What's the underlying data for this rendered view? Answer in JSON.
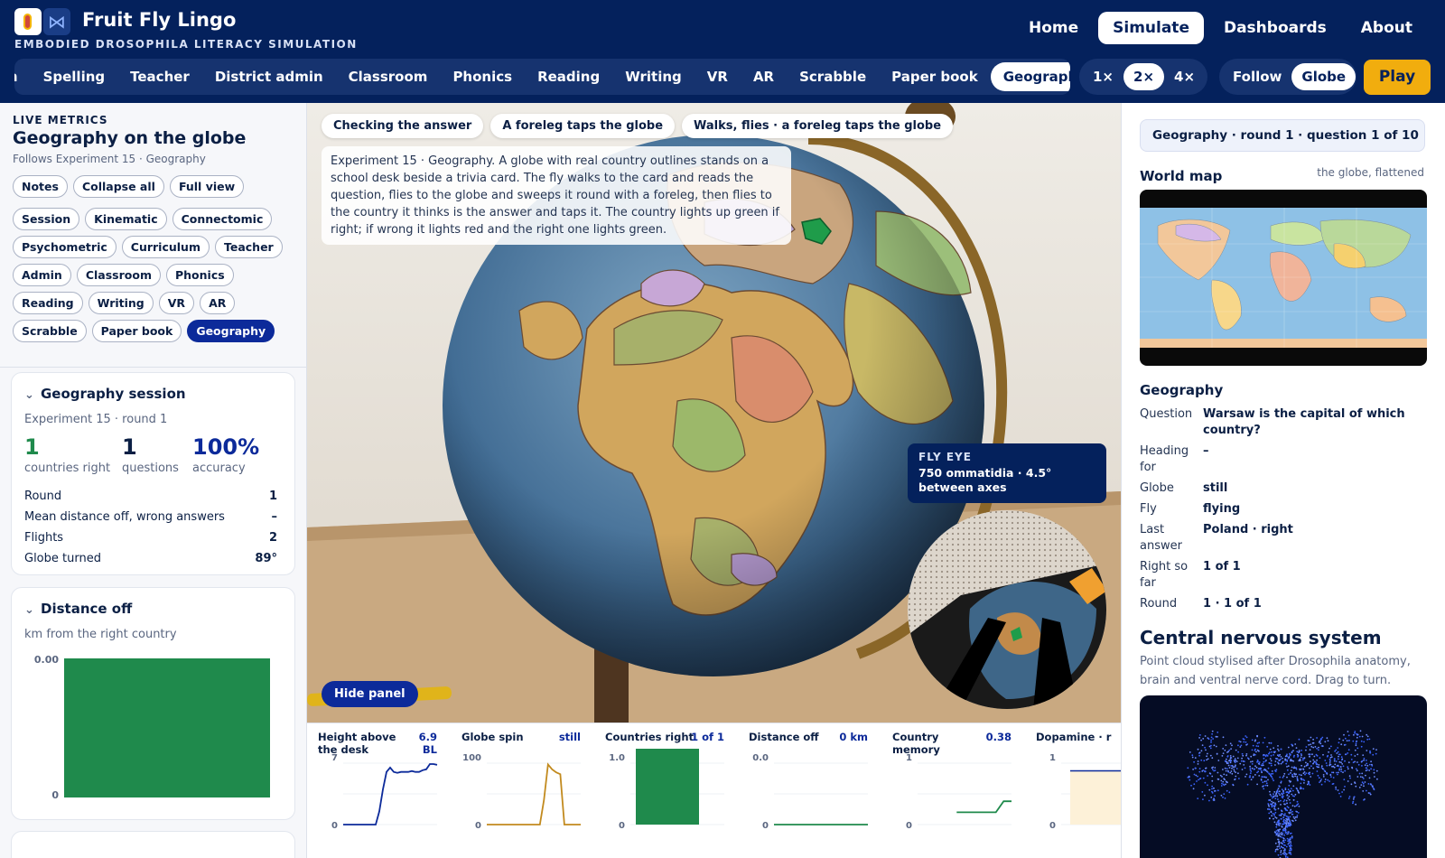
{
  "header": {
    "title": "Fruit Fly Lingo",
    "subtitle": "EMBODIED DROSOPHILA LITERACY SIMULATION",
    "nav": [
      "Home",
      "Simulate",
      "Dashboards",
      "About"
    ],
    "nav_active": "Simulate"
  },
  "modes": [
    "ch",
    "Spelling",
    "Teacher",
    "District admin",
    "Classroom",
    "Phonics",
    "Reading",
    "Writing",
    "VR",
    "AR",
    "Scrabble",
    "Paper book",
    "Geography"
  ],
  "mode_active": "Geography",
  "speeds": [
    "1×",
    "2×",
    "4×"
  ],
  "speed_active": "2×",
  "cameras": [
    "Follow",
    "Globe"
  ],
  "camera_active": "Globe",
  "play_label": "Play",
  "left": {
    "eyebrow": "LIVE METRICS",
    "title": "Geography on the globe",
    "subtitle": "Follows Experiment 15 · Geography",
    "view_chips": [
      "Notes",
      "Collapse all",
      "Full view"
    ],
    "panel_chips": [
      "Session",
      "Kinematic",
      "Connectomic",
      "Psychometric",
      "Curriculum",
      "Teacher",
      "Admin",
      "Classroom",
      "Phonics",
      "Reading",
      "Writing",
      "VR",
      "AR",
      "Scrabble",
      "Paper book",
      "Geography"
    ],
    "panel_chip_active": "Geography",
    "session": {
      "title": "Geography session",
      "sub": "Experiment 15 · round 1",
      "stats": [
        {
          "value": "1",
          "label": "countries right",
          "color": "#1f8a4c"
        },
        {
          "value": "1",
          "label": "questions",
          "color": "#0b1f44"
        },
        {
          "value": "100%",
          "label": "accuracy",
          "color": "#0c2a9a"
        }
      ],
      "rows": [
        {
          "label": "Round",
          "value": "1"
        },
        {
          "label": "Mean distance off, wrong answers",
          "value": "–"
        },
        {
          "label": "Flights",
          "value": "2"
        },
        {
          "label": "Globe turned",
          "value": "89°"
        }
      ]
    },
    "distance": {
      "title": "Distance off",
      "sub": "km from the right country",
      "ytop": "0.00",
      "ybottom": "0",
      "color": "#1f8a4c"
    }
  },
  "scene": {
    "pills": [
      "Checking the answer",
      "A foreleg taps the globe",
      "Walks, flies · a foreleg taps the globe"
    ],
    "description": "Experiment 15 · Geography. A globe with real country outlines stands on a school desk beside a trivia card. The fly walks to the card and reads the question, flies to the globe and sweeps it round with a foreleg, then flies to the country it thinks is the answer and taps it. The country lights up green if right; if wrong it lights red and the right one lights green.",
    "hide_panel": "Hide panel",
    "fly_eye_title": "FLY EYE",
    "fly_eye_body": "750 ommatidia · 4.5° between axes"
  },
  "sparks": [
    {
      "title": "Height above the desk",
      "value": "6.9 BL",
      "ymax": "7",
      "ymin": "0",
      "kind": "line",
      "color": "#0c2a9a",
      "values": [
        0,
        0,
        0,
        0,
        0,
        0,
        0,
        0,
        0,
        0,
        1.5,
        4,
        6,
        6.5,
        6,
        5.9,
        6,
        6,
        6,
        6.1,
        6,
        6,
        6.2,
        6.3,
        6.9,
        6.9,
        6.8
      ]
    },
    {
      "title": "Globe spin",
      "value": "still",
      "ymax": "100",
      "ymin": "0",
      "kind": "line",
      "color": "#c28a1e",
      "values": [
        0,
        0,
        0,
        0,
        0,
        0,
        0,
        0,
        0,
        0,
        0,
        0,
        0,
        0,
        40,
        98,
        90,
        85,
        82,
        0,
        0,
        0,
        0,
        0
      ]
    },
    {
      "title": "Countries right",
      "value": "1 of 1",
      "ymax": "1.0",
      "ymin": "0",
      "kind": "bar",
      "color": "#1f8a4c",
      "values": [
        1
      ]
    },
    {
      "title": "Distance off",
      "value": "0 km",
      "ymax": "0.0",
      "ymin": "0",
      "kind": "line",
      "color": "#1f8a4c",
      "values": [
        0,
        0,
        0,
        0,
        0,
        0,
        0,
        0,
        0,
        0
      ]
    },
    {
      "title": "Country memory",
      "value": "0.38",
      "ymax": "1",
      "ymin": "0",
      "kind": "line",
      "color": "#1f8a4c",
      "values": [
        null,
        null,
        null,
        null,
        null,
        0.2,
        0.2,
        0.2,
        0.2,
        0.2,
        0.2,
        0.38,
        0.38
      ]
    },
    {
      "title": "Dopamine · r",
      "value": "",
      "ymax": "1",
      "ymin": "0",
      "kind": "area",
      "color": "#0c2a9a",
      "values": [
        0.5,
        0.5,
        0.5,
        0.5,
        0.5
      ]
    }
  ],
  "right": {
    "question_badge": "Geography · round 1 · question 1 of 10",
    "world_map_title": "World map",
    "world_map_note": "the globe, flattened",
    "geo_title": "Geography",
    "info": [
      {
        "k": "Question",
        "v": "Warsaw is the capital of which country?"
      },
      {
        "k": "Heading for",
        "v": "–"
      },
      {
        "k": "Globe",
        "v": "still"
      },
      {
        "k": "Fly",
        "v": "flying"
      },
      {
        "k": "Last answer",
        "v": "Poland · right"
      },
      {
        "k": "Right so far",
        "v": "1 of 1"
      },
      {
        "k": "Round",
        "v": "1 · 1 of 1"
      }
    ],
    "cns_title": "Central nervous system",
    "cns_sub": "Point cloud stylised after Drosophila anatomy, brain and ventral nerve cord. Drag to turn."
  },
  "colors": {
    "navy": "#04215c",
    "accent": "#0c2a9a",
    "green": "#1f8a4c",
    "gold": "#f1ad0e"
  }
}
